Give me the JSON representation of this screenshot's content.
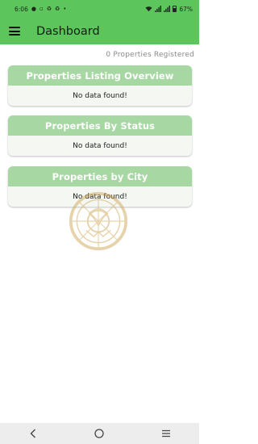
{
  "status_bar": {
    "time": "6:06",
    "notification_icons": [
      "messenger-icon",
      "image-icon",
      "recycle-icon",
      "recycle-icon",
      "dot-icon"
    ],
    "battery_percent": "67%",
    "battery_level": 0.67
  },
  "app_bar": {
    "title": "Dashboard",
    "menu_icon": "hamburger-menu-icon"
  },
  "summary": {
    "registered_text": "0 Properties Registered"
  },
  "cards": [
    {
      "title": "Properties Listing Overview",
      "body": "No data found!"
    },
    {
      "title": "Properties By Status",
      "body": "No data found!"
    },
    {
      "title": "Properties by City",
      "body": "No data found!"
    }
  ],
  "nav_bar": {
    "back_icon": "back-chevron-icon",
    "home_icon": "home-circle-icon",
    "recents_icon": "recents-lines-icon"
  },
  "colors": {
    "primary": "#5cc55b",
    "card_header": "#a7d7a3",
    "card_body": "#f5f7f3"
  }
}
